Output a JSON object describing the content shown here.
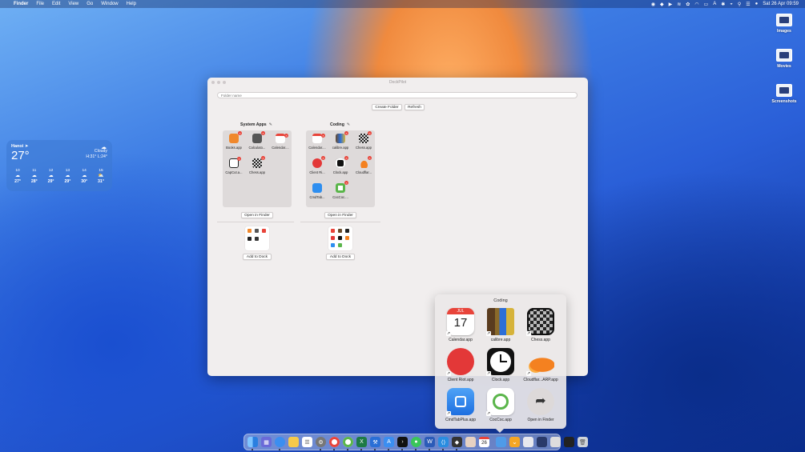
{
  "menubar": {
    "app_name": "Finder",
    "items": [
      "File",
      "Edit",
      "View",
      "Go",
      "Window",
      "Help"
    ],
    "datetime": "Sat 26 Apr  09:59"
  },
  "desktop": {
    "items": [
      {
        "label": "Images"
      },
      {
        "label": "Movies"
      },
      {
        "label": "Screenshots"
      }
    ]
  },
  "weather": {
    "city": "Hanoi",
    "temp": "27°",
    "condition": "Cloudy",
    "hilo": "H:31° L:24°",
    "hours": [
      {
        "time": "10",
        "temp": "27°"
      },
      {
        "time": "11",
        "temp": "28°"
      },
      {
        "time": "12",
        "temp": "29°"
      },
      {
        "time": "13",
        "temp": "29°"
      },
      {
        "time": "14",
        "temp": "30°"
      },
      {
        "time": "15",
        "temp": "31°"
      }
    ]
  },
  "window": {
    "title": "DockPilot",
    "folder_name_placeholder": "Folder name",
    "create_folder": "Create Folder",
    "refresh": "Refresh",
    "folders": [
      {
        "name": "System Apps",
        "apps": [
          "Books.app",
          "Calculato...",
          "Calendar....",
          "CapCut.a...",
          "Chess.app"
        ],
        "open_in_finder": "Open in Finder",
        "add_to_dock": "Add to Dock"
      },
      {
        "name": "Coding",
        "apps": [
          "Calendar....",
          "calibre.app",
          "Chess.app",
          "Client Ri...",
          "Clock.app",
          "Cloudflar...",
          "CmdTab...",
          "CocCoc...."
        ],
        "open_in_finder": "Open in Finder",
        "add_to_dock": "Add to Dock"
      }
    ]
  },
  "stack": {
    "title": "Coding",
    "calendar_month": "JUL",
    "calendar_day": "17",
    "items": [
      {
        "label": "Calendar.app"
      },
      {
        "label": "calibre.app"
      },
      {
        "label": "Chess.app"
      },
      {
        "label": "Client Riot.app"
      },
      {
        "label": "Clock.app"
      },
      {
        "label": "Cloudflar...ARP.app"
      },
      {
        "label": "CmdTabPlus.app"
      },
      {
        "label": "CocCoc.app"
      },
      {
        "label": "Open in Finder"
      }
    ]
  },
  "dock": {
    "calendar_day": "26"
  },
  "colors": {
    "delete_badge": "#e8443a",
    "window_bg": "#f1eeee"
  }
}
